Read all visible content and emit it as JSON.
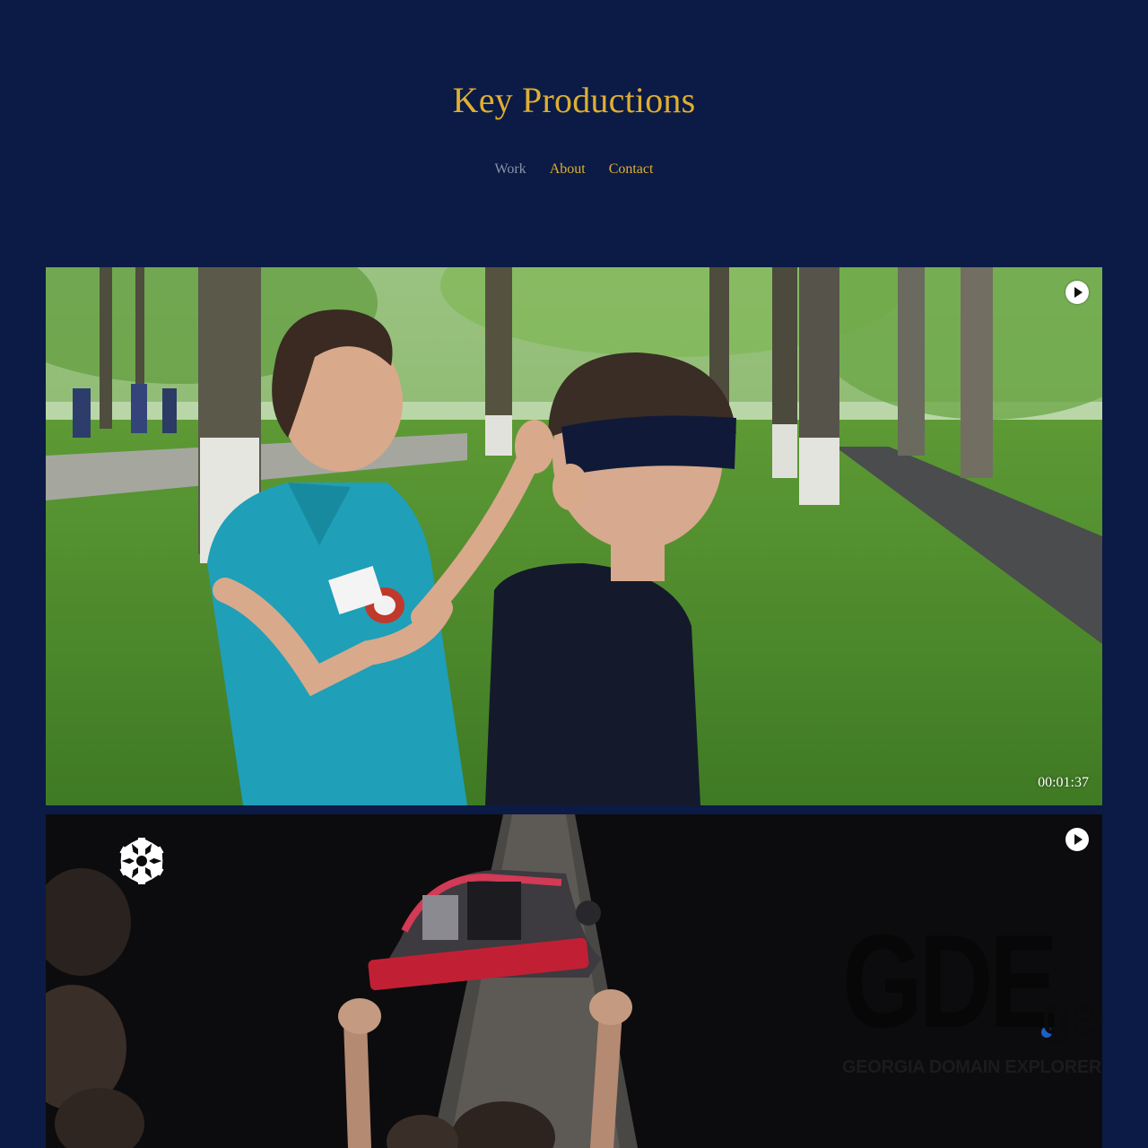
{
  "site": {
    "title": "Key Productions"
  },
  "nav": {
    "items": [
      "Work",
      "About",
      "Contact"
    ],
    "current": "Work"
  },
  "videos": [
    {
      "duration": "00:01:37",
      "play_icon": "play-icon"
    },
    {
      "play_icon": "play-icon",
      "logo": {
        "main": "GDE",
        "tld": "ge",
        "tagline": "GEORGIA DOMAIN EXPLORER"
      }
    }
  ],
  "colors": {
    "background": "#0b1b45",
    "accent": "#dfae31",
    "nav_current": "#8a93a8"
  }
}
